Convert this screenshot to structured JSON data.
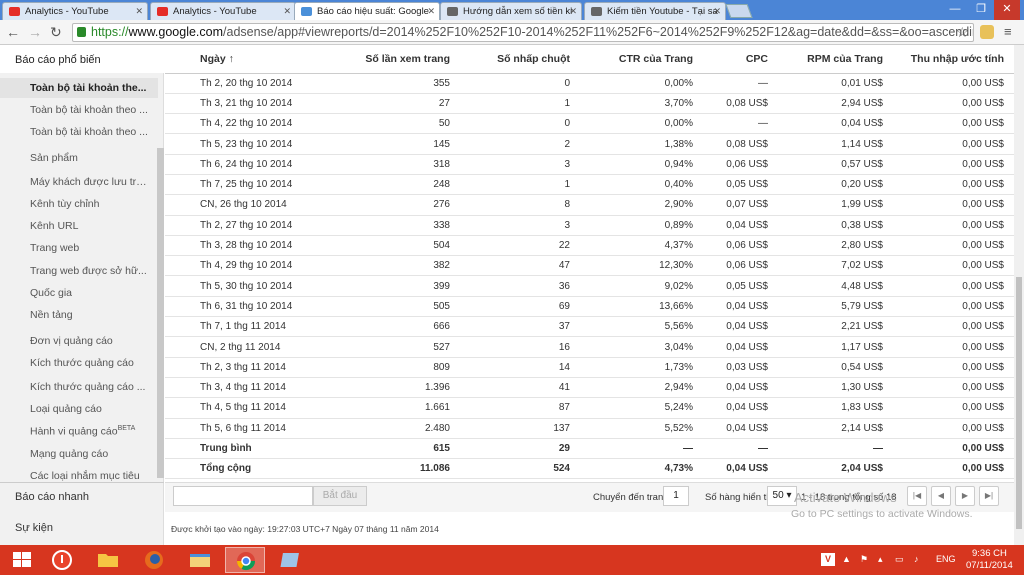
{
  "browser": {
    "tabs": [
      {
        "title": "Analytics - YouTube",
        "icon": "youtube-icon",
        "color": "#e52d27"
      },
      {
        "title": "Analytics - YouTube",
        "icon": "youtube-icon",
        "color": "#e52d27"
      },
      {
        "title": "Báo cáo hiệu suất: Google",
        "icon": "adsense-icon",
        "color": "#4a90d9",
        "active": true
      },
      {
        "title": "Hướng dẫn xem số tiền ki",
        "icon": "page-icon",
        "color": "#666666"
      },
      {
        "title": "Kiếm tiền Youtube - Tại sa",
        "icon": "page-icon",
        "color": "#666666"
      }
    ],
    "url_scheme": "https://",
    "url_host": "www.google.com",
    "url_path": "/adsense/app#viewreports/d=2014%252F10%252F10-2014%252F11%252F6~2014%252F9%252F12&ag=date&dd=&ss=&oo=ascending&"
  },
  "sidebar": {
    "header": "Báo cáo phổ biến",
    "selected": "Toàn bộ tài khoản the...",
    "items": [
      "Toàn bộ tài khoản theo ...",
      "Toàn bộ tài khoản theo ...",
      "Sản phẩm",
      "Máy khách được lưu trữ ...",
      "Kênh tùy chỉnh",
      "Kênh URL",
      "Trang web",
      "Trang web được sở hữ...",
      "Quốc gia",
      "Nền tảng",
      "Đơn vị quảng cáo",
      "Kích thước quảng cáo",
      "Kích thước quảng cáo ...",
      "Loại quảng cáo",
      "Hành vi quảng cáo",
      "Mạng quảng cáo",
      "Các loại nhắm mục tiêu"
    ],
    "beta": "BETA",
    "quick_reports": "Báo cáo nhanh",
    "events": "Sự kiện"
  },
  "table": {
    "headers": [
      "Ngày ↑",
      "Số lần xem trang",
      "Số nhấp chuột",
      "CTR của Trang",
      "CPC",
      "RPM của Trang",
      "Thu nhập ước tính"
    ],
    "rows": [
      [
        "Th 2, 20 thg 10 2014",
        "355",
        "0",
        "0,00%",
        "—",
        "0,01 US$",
        "0,00 US$"
      ],
      [
        "Th 3, 21 thg 10 2014",
        "27",
        "1",
        "3,70%",
        "0,08 US$",
        "2,94 US$",
        "0,00 US$"
      ],
      [
        "Th 4, 22 thg 10 2014",
        "50",
        "0",
        "0,00%",
        "—",
        "0,04 US$",
        "0,00 US$"
      ],
      [
        "Th 5, 23 thg 10 2014",
        "145",
        "2",
        "1,38%",
        "0,08 US$",
        "1,14 US$",
        "0,00 US$"
      ],
      [
        "Th 6, 24 thg 10 2014",
        "318",
        "3",
        "0,94%",
        "0,06 US$",
        "0,57 US$",
        "0,00 US$"
      ],
      [
        "Th 7, 25 thg 10 2014",
        "248",
        "1",
        "0,40%",
        "0,05 US$",
        "0,20 US$",
        "0,00 US$"
      ],
      [
        "CN, 26 thg 10 2014",
        "276",
        "8",
        "2,90%",
        "0,07 US$",
        "1,99 US$",
        "0,00 US$"
      ],
      [
        "Th 2, 27 thg 10 2014",
        "338",
        "3",
        "0,89%",
        "0,04 US$",
        "0,38 US$",
        "0,00 US$"
      ],
      [
        "Th 3, 28 thg 10 2014",
        "504",
        "22",
        "4,37%",
        "0,06 US$",
        "2,80 US$",
        "0,00 US$"
      ],
      [
        "Th 4, 29 thg 10 2014",
        "382",
        "47",
        "12,30%",
        "0,06 US$",
        "7,02 US$",
        "0,00 US$"
      ],
      [
        "Th 5, 30 thg 10 2014",
        "399",
        "36",
        "9,02%",
        "0,05 US$",
        "4,48 US$",
        "0,00 US$"
      ],
      [
        "Th 6, 31 thg 10 2014",
        "505",
        "69",
        "13,66%",
        "0,04 US$",
        "5,79 US$",
        "0,00 US$"
      ],
      [
        "Th 7, 1 thg 11 2014",
        "666",
        "37",
        "5,56%",
        "0,04 US$",
        "2,21 US$",
        "0,00 US$"
      ],
      [
        "CN, 2 thg 11 2014",
        "527",
        "16",
        "3,04%",
        "0,04 US$",
        "1,17 US$",
        "0,00 US$"
      ],
      [
        "Th 2, 3 thg 11 2014",
        "809",
        "14",
        "1,73%",
        "0,03 US$",
        "0,54 US$",
        "0,00 US$"
      ],
      [
        "Th 3, 4 thg 11 2014",
        "1.396",
        "41",
        "2,94%",
        "0,04 US$",
        "1,30 US$",
        "0,00 US$"
      ],
      [
        "Th 4, 5 thg 11 2014",
        "1.661",
        "87",
        "5,24%",
        "0,04 US$",
        "1,83 US$",
        "0,00 US$"
      ],
      [
        "Th 5, 6 thg 11 2014",
        "2.480",
        "137",
        "5,52%",
        "0,04 US$",
        "2,14 US$",
        "0,00 US$"
      ]
    ],
    "average": [
      "Trung bình",
      "615",
      "29",
      "—",
      "—",
      "—",
      "0,00 US$"
    ],
    "total": [
      "Tổng cộng",
      "11.086",
      "524",
      "4,73%",
      "0,04 US$",
      "2,04 US$",
      "0,00 US$"
    ]
  },
  "pager": {
    "start_button": "Bắt đầu",
    "goto_label": "Chuyển đến trang:",
    "goto_value": "1",
    "rows_label": "Số hàng hiển thị:",
    "rows_value": "50",
    "range_text": "1 - 18 trong tổng số 18"
  },
  "footer": {
    "created": "Được khởi tạo vào ngày: 19:27:03 UTC+7 Ngày 07 tháng 11 năm 2014"
  },
  "watermark": {
    "line1": "Activate Windows",
    "line2": "Go to PC settings to activate Windows."
  },
  "taskbar": {
    "language": "ENG",
    "time": "9:36 CH",
    "date": "07/11/2014"
  }
}
